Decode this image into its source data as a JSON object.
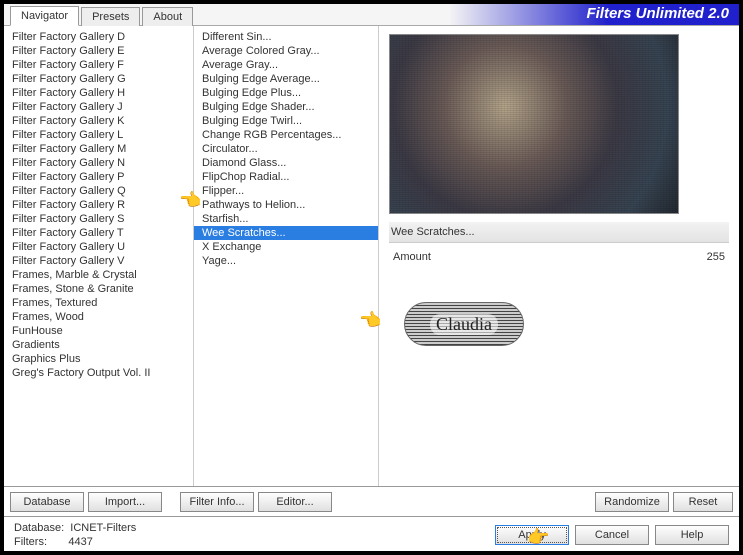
{
  "app_title": "Filters Unlimited 2.0",
  "tabs": {
    "navigator": "Navigator",
    "presets": "Presets",
    "about": "About"
  },
  "nav_items": [
    "Filter Factory Gallery D",
    "Filter Factory Gallery E",
    "Filter Factory Gallery F",
    "Filter Factory Gallery G",
    "Filter Factory Gallery H",
    "Filter Factory Gallery J",
    "Filter Factory Gallery K",
    "Filter Factory Gallery L",
    "Filter Factory Gallery M",
    "Filter Factory Gallery N",
    "Filter Factory Gallery P",
    "Filter Factory Gallery Q",
    "Filter Factory Gallery R",
    "Filter Factory Gallery S",
    "Filter Factory Gallery T",
    "Filter Factory Gallery U",
    "Filter Factory Gallery V",
    "Frames, Marble & Crystal",
    "Frames, Stone & Granite",
    "Frames, Textured",
    "Frames, Wood",
    "FunHouse",
    "Gradients",
    "Graphics Plus",
    "Greg's Factory Output Vol. II"
  ],
  "filter_items": [
    "Different Sin...",
    "Average Colored Gray...",
    "Average Gray...",
    "Bulging Edge Average...",
    "Bulging Edge Plus...",
    "Bulging Edge Shader...",
    "Bulging Edge Twirl...",
    "Change RGB Percentages...",
    "Circulator...",
    "Diamond Glass...",
    "FlipChop Radial...",
    "Flipper...",
    "Pathways to Helion...",
    "Starfish...",
    "Wee Scratches...",
    "X Exchange",
    "Yage..."
  ],
  "selected_filter": "Wee Scratches...",
  "param": {
    "label": "Amount",
    "value": "255"
  },
  "buttons": {
    "database": "Database",
    "import": "Import...",
    "filter_info": "Filter Info...",
    "editor": "Editor...",
    "randomize": "Randomize",
    "reset": "Reset",
    "apply": "Apply",
    "cancel": "Cancel",
    "help": "Help"
  },
  "footer": {
    "db_label": "Database:",
    "db_value": "ICNET-Filters",
    "filters_label": "Filters:",
    "filters_value": "4437"
  },
  "watermark": "Claudia"
}
